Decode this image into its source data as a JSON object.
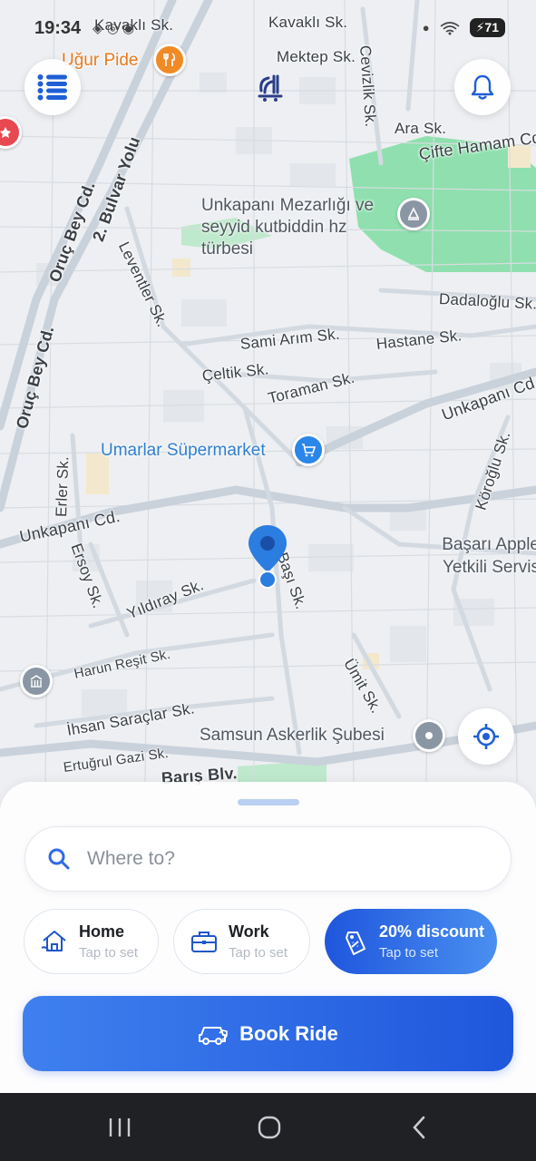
{
  "status_bar": {
    "time": "19:34",
    "battery": "71"
  },
  "map": {
    "streets": [
      "Kavaklı Sk.",
      "Kavaklı Sk.",
      "Mektep Sk.",
      "Cevizlik Sk.",
      "Ara Sk.",
      "Çifte Hamam Cd.",
      "2. Bulvar Yolu",
      "Oruç Bey Cd.",
      "Oruç Bey Cd.",
      "Leventler Sk.",
      "Dadaloğlu Sk.",
      "Sami Arım Sk.",
      "Hastane Sk.",
      "Çeltik Sk.",
      "Toraman Sk.",
      "Unkapanı Cd.",
      "Köroğlu Sk.",
      "Erler Sk.",
      "Unkapanı Cd.",
      "Ersoy Sk.",
      "Yıldıray Sk.",
      "Harun Reşit Sk.",
      "İhsan Saraçlar Sk.",
      "Ertuğrul Gazi Sk.",
      "Barış Blv.",
      "Ümit Sk.",
      "Başı Sk."
    ],
    "pois": {
      "ugur_pide": "Uğur Pide",
      "cemetery": "Unkapanı Mezarlığı ve seyyid kutbiddin hz türbesi",
      "supermarket": "Umarlar Süpermarket",
      "apple": "Başarı Apple Yetkili Servis",
      "askerlik": "Samsun Askerlik Şubesi"
    }
  },
  "bottom_sheet": {
    "search": {
      "placeholder": "Where to?",
      "value": ""
    },
    "shortcuts": [
      {
        "title": "Home",
        "subtitle": "Tap to set",
        "icon": "home-icon"
      },
      {
        "title": "Work",
        "subtitle": "Tap to set",
        "icon": "briefcase-icon"
      },
      {
        "title": "20% discount",
        "subtitle": "Tap to set",
        "icon": "discount-tag-icon"
      }
    ],
    "book_button": {
      "label": "Book Ride",
      "icon": "car-icon"
    }
  },
  "colors": {
    "primary": "#2f6ae6",
    "park": "#8fe0ae",
    "navbar": "#1f2124"
  }
}
